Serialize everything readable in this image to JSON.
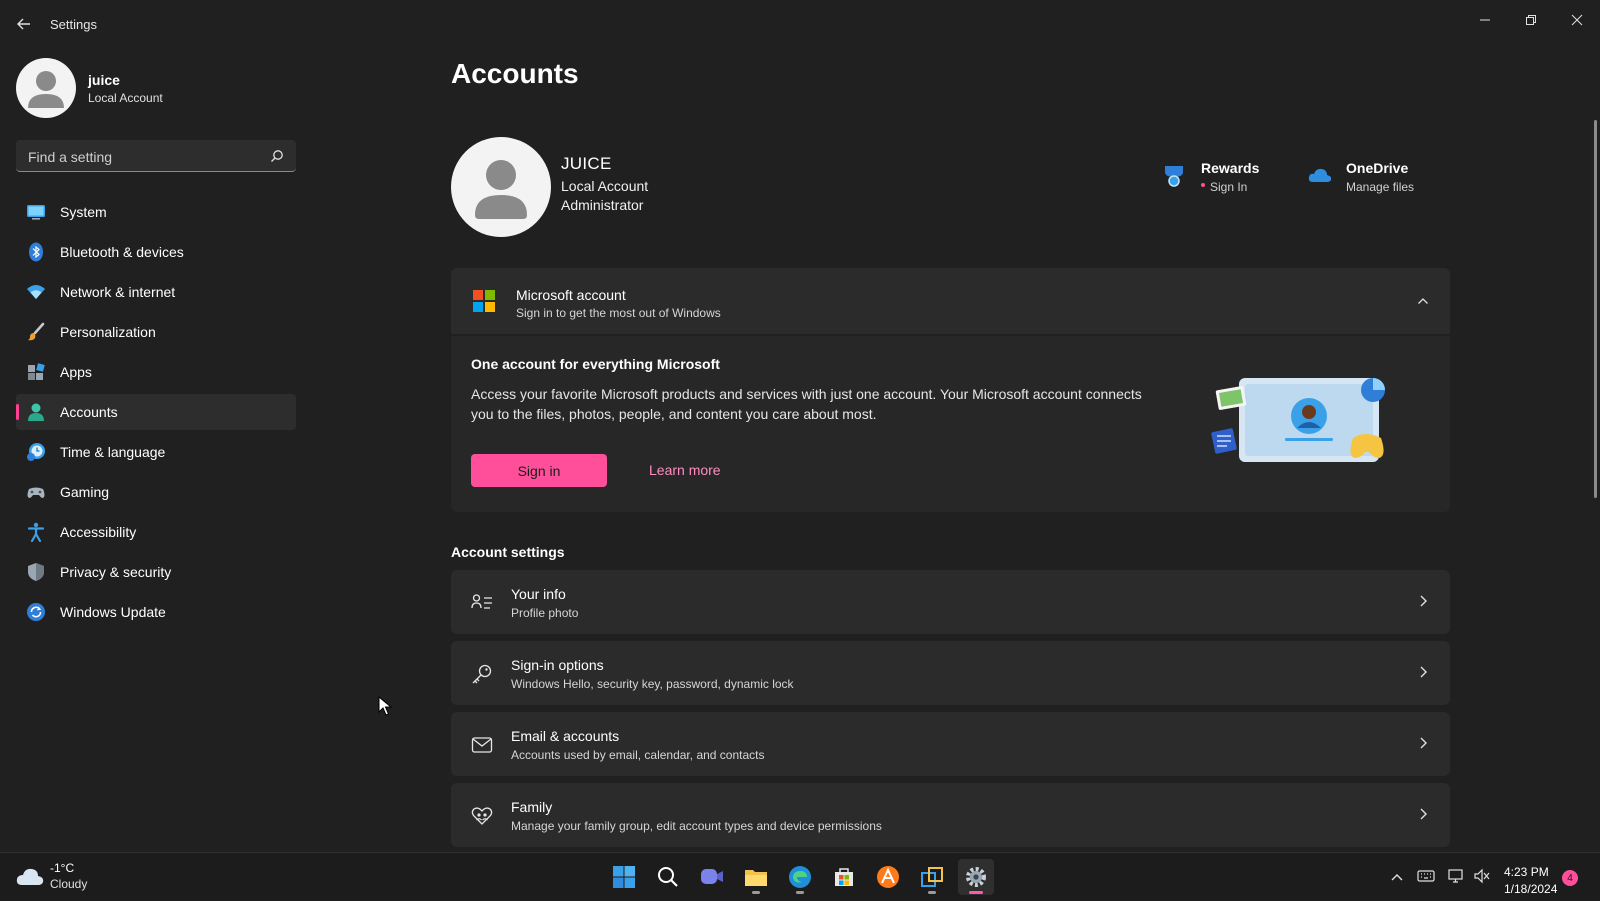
{
  "window": {
    "title": "Settings"
  },
  "user": {
    "name": "juice",
    "account_type": "Local Account"
  },
  "search": {
    "placeholder": "Find a setting"
  },
  "nav": [
    {
      "label": "System",
      "icon": "monitor-icon"
    },
    {
      "label": "Bluetooth & devices",
      "icon": "bluetooth-icon"
    },
    {
      "label": "Network & internet",
      "icon": "wifi-icon"
    },
    {
      "label": "Personalization",
      "icon": "brush-icon"
    },
    {
      "label": "Apps",
      "icon": "apps-icon"
    },
    {
      "label": "Accounts",
      "icon": "person-icon",
      "active": true
    },
    {
      "label": "Time & language",
      "icon": "clock-globe-icon"
    },
    {
      "label": "Gaming",
      "icon": "gamepad-icon"
    },
    {
      "label": "Accessibility",
      "icon": "accessibility-icon"
    },
    {
      "label": "Privacy & security",
      "icon": "shield-icon"
    },
    {
      "label": "Windows Update",
      "icon": "update-icon"
    }
  ],
  "page": {
    "title": "Accounts"
  },
  "profile": {
    "name": "JUICE",
    "line1": "Local Account",
    "line2": "Administrator"
  },
  "services": {
    "rewards": {
      "title": "Rewards",
      "sub": "Sign In"
    },
    "onedrive": {
      "title": "OneDrive",
      "sub": "Manage files"
    }
  },
  "ms_account": {
    "title": "Microsoft account",
    "subtitle": "Sign in to get the most out of Windows",
    "heading": "One account for everything Microsoft",
    "body": "Access your favorite Microsoft products and services with just one account. Your Microsoft account connects you to the files, photos, people, and content you care about most.",
    "sign_in_label": "Sign in",
    "learn_more_label": "Learn more"
  },
  "account_settings": {
    "title": "Account settings",
    "items": [
      {
        "title": "Your info",
        "sub": "Profile photo",
        "icon": "person-list-icon"
      },
      {
        "title": "Sign-in options",
        "sub": "Windows Hello, security key, password, dynamic lock",
        "icon": "key-icon"
      },
      {
        "title": "Email & accounts",
        "sub": "Accounts used by email, calendar, and contacts",
        "icon": "mail-icon"
      },
      {
        "title": "Family",
        "sub": "Manage your family group, edit account types and device permissions",
        "icon": "family-heart-icon"
      }
    ]
  },
  "taskbar": {
    "weather": {
      "temp": "-1°C",
      "condition": "Cloudy"
    },
    "clock": {
      "time": "4:23 PM",
      "date": "1/18/2024"
    },
    "notification_count": "4"
  },
  "colors": {
    "accent": "#ff4f9a",
    "background": "#202020",
    "card": "#2b2b2b"
  }
}
